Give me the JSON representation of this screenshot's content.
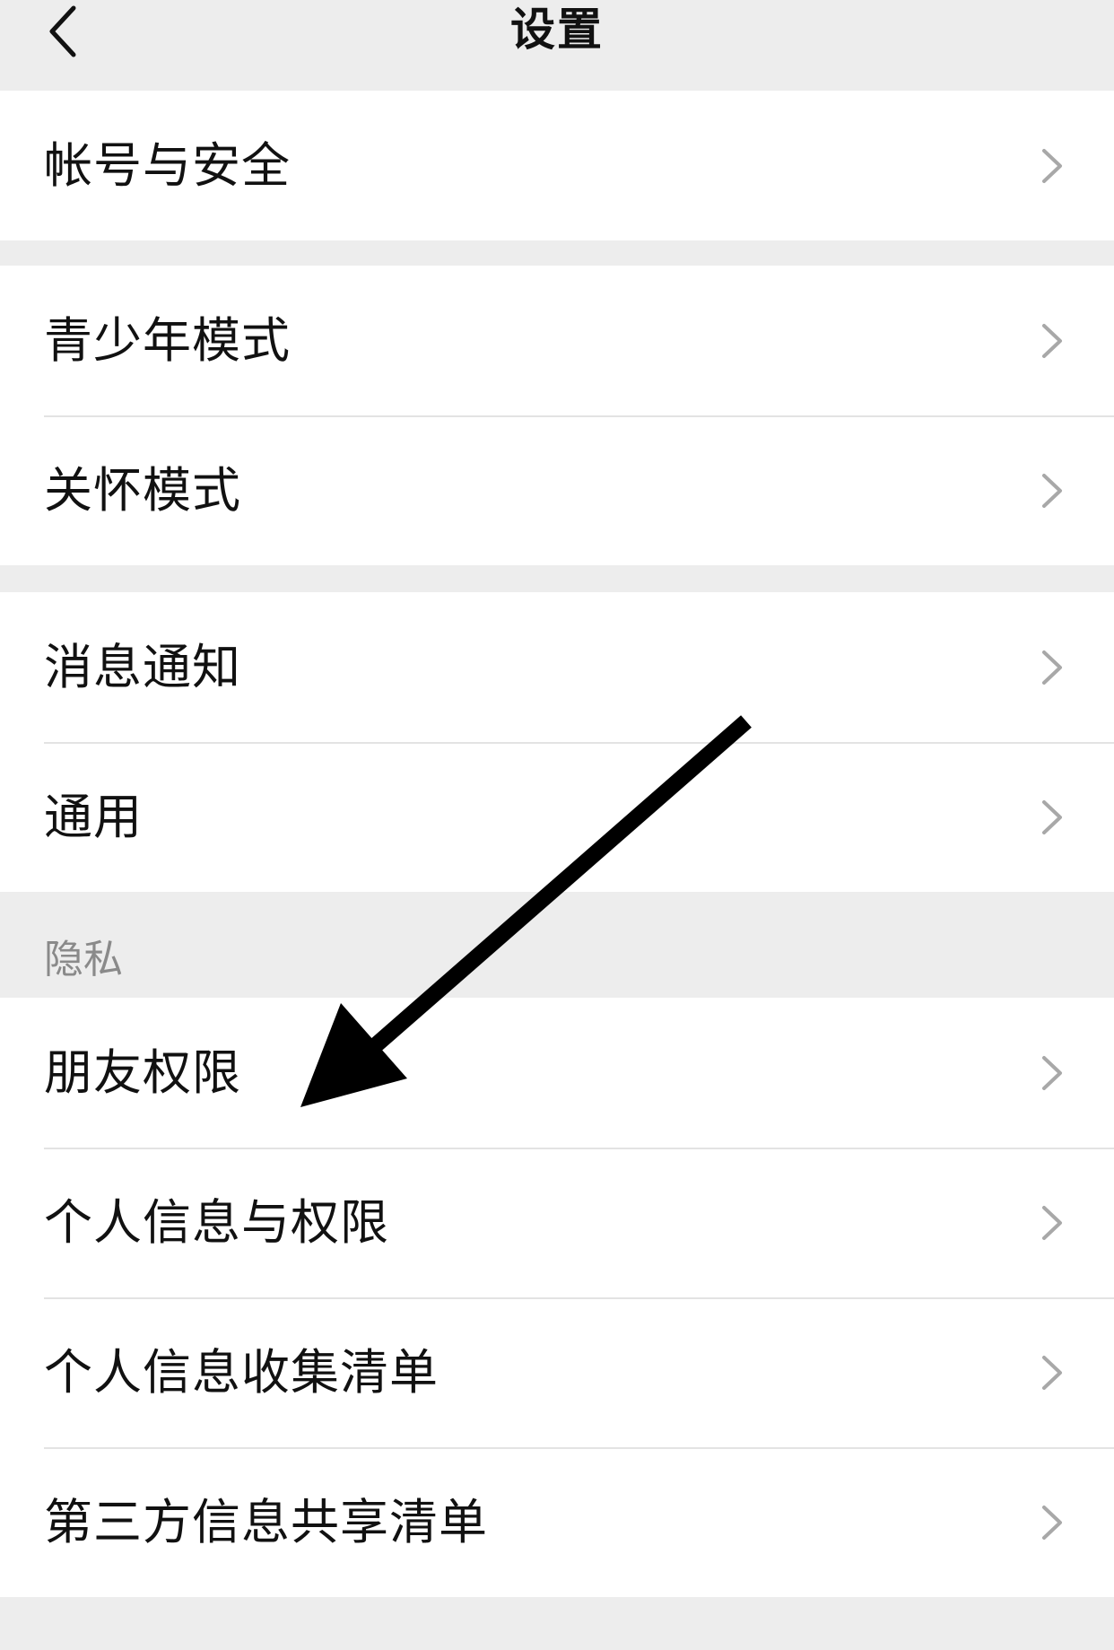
{
  "header": {
    "title": "设置",
    "back_icon": "chevron-left-icon"
  },
  "groups": [
    {
      "items": [
        {
          "label": "帐号与安全"
        }
      ]
    },
    {
      "items": [
        {
          "label": "青少年模式"
        },
        {
          "label": "关怀模式"
        }
      ]
    },
    {
      "items": [
        {
          "label": "消息通知"
        },
        {
          "label": "通用"
        }
      ]
    },
    {
      "section_title": "隐私",
      "items": [
        {
          "label": "朋友权限"
        },
        {
          "label": "个人信息与权限"
        },
        {
          "label": "个人信息收集清单"
        },
        {
          "label": "第三方信息共享清单"
        }
      ]
    }
  ],
  "row_icon": "chevron-right-icon",
  "annotation": {
    "icon": "arrow-annotation-icon",
    "color": "#000000"
  },
  "colors": {
    "background": "#ededed",
    "row_background": "#ffffff",
    "chevron": "#a8a8a8",
    "section_title": "#8a8a8a"
  }
}
